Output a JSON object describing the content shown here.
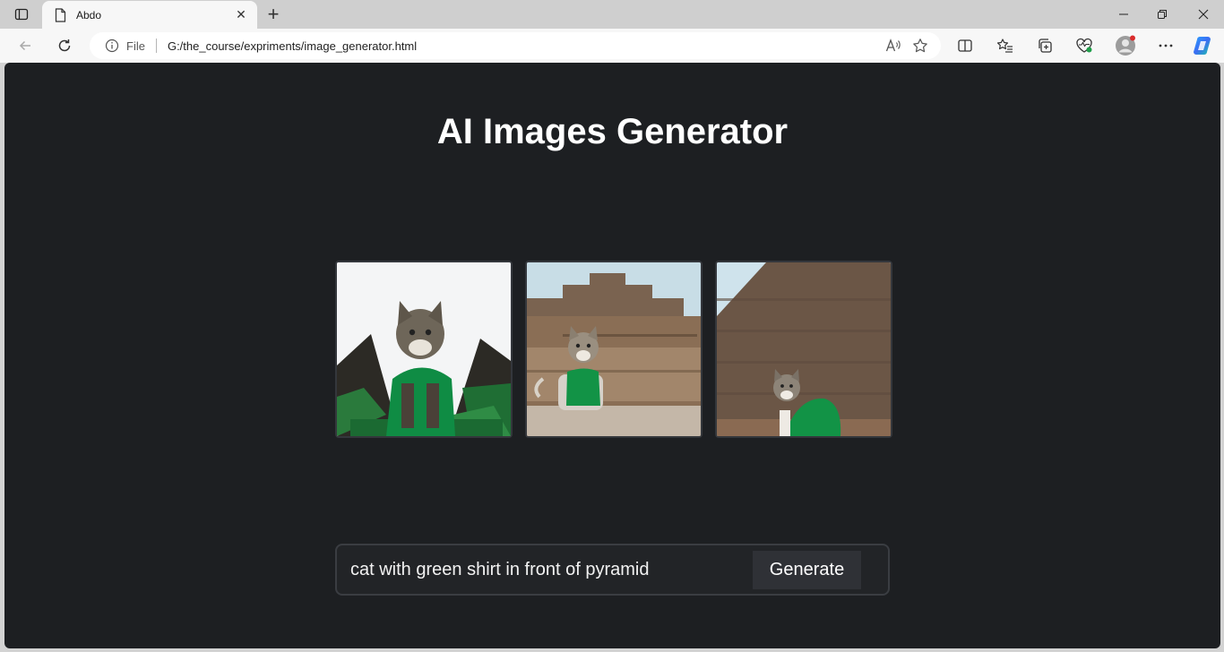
{
  "browser": {
    "tab_title": "Abdo",
    "address": {
      "scheme_label": "File",
      "url": "G:/the_course/expriments/image_generator.html"
    }
  },
  "page": {
    "title": "AI Images Generator",
    "gallery": [
      {
        "icon": "cat-green-shirt-image-1"
      },
      {
        "icon": "cat-green-shirt-image-2"
      },
      {
        "icon": "cat-green-shirt-image-3"
      }
    ],
    "prompt": {
      "value": "cat with green shirt in front of pyramid",
      "button_label": "Generate"
    }
  },
  "colors": {
    "page_background": "#1d1f22",
    "shirt_green": "#129346",
    "button_background": "#2f3136"
  }
}
